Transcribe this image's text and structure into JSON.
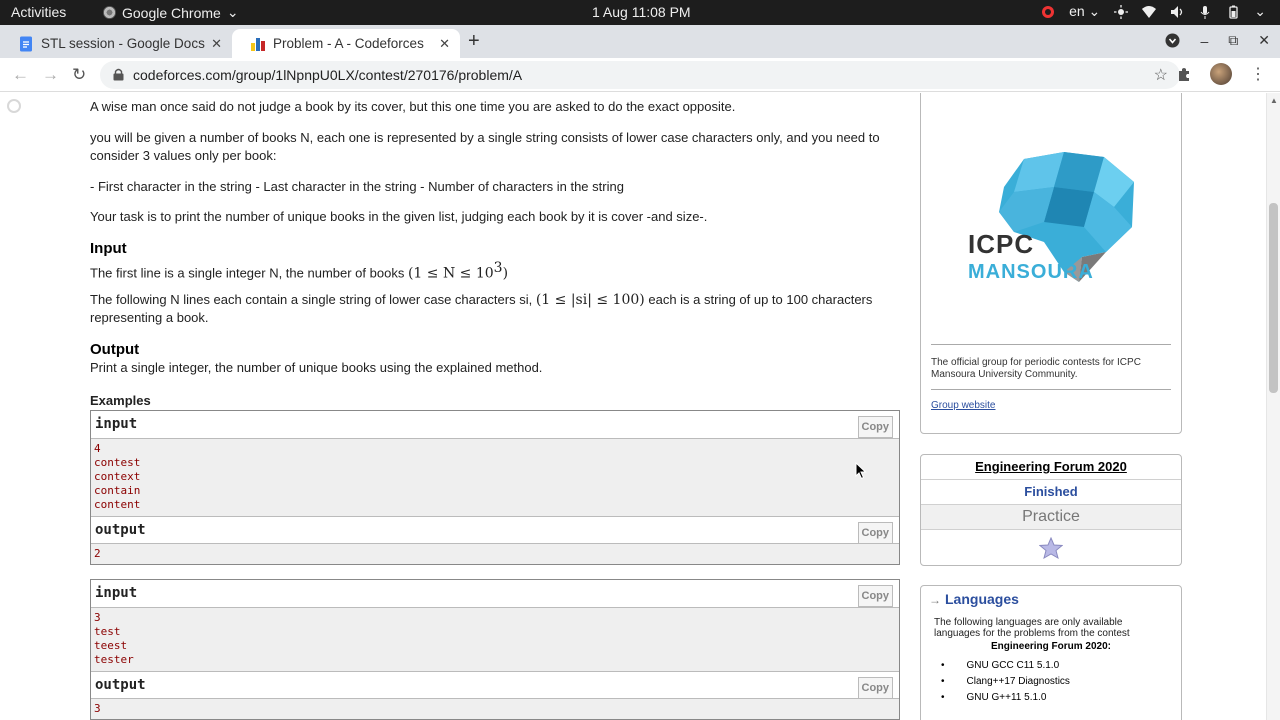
{
  "system_bar": {
    "activities": "Activities",
    "app_name": "Google Chrome",
    "clock": "1 Aug  11:08 PM",
    "language": "en"
  },
  "tabs": [
    {
      "title": "STL session - Google Docs",
      "icon": "google-docs-icon"
    },
    {
      "title": "Problem - A - Codeforces",
      "icon": "codeforces-icon"
    }
  ],
  "address_bar": {
    "url": "codeforces.com/group/1lNpnpU0LX/contest/270176/problem/A"
  },
  "problem": {
    "statement_1": "A wise man once said do not judge a book by its cover, but this one time you are asked to do the exact opposite.",
    "statement_2": "you will be given a number of books N, each one is represented by a single string consists of lower case characters only, and you need to consider 3 values only per book:",
    "statement_3": "- First character in the string - Last character in the string - Number of characters in the string",
    "statement_4": "Your task is to print the number of unique books in the given list, judging each book by it is cover -and size-.",
    "input_title": "Input",
    "input_line_1_text": "The first line is a single integer N, the number of books ",
    "input_line_1_math": "(1 ≤ N ≤ 10",
    "input_line_1_exp": "3",
    "input_line_1_close": ")",
    "input_line_2_text": "The following N lines each contain a single string of lower case characters si, ",
    "input_line_2_math": "(1 ≤ |si| ≤ 100)",
    "input_line_2_rest": " each is a string of up to 100 characters representing a book.",
    "output_title": "Output",
    "output_text": "Print a single integer, the number of unique books using the explained method.",
    "examples_title": "Examples",
    "copy_label": "Copy",
    "input_label": "input",
    "output_label": "output",
    "examples": [
      {
        "input": "4\ncontest\ncontext\ncontain\ncontent",
        "output": "2"
      },
      {
        "input": "3\ntest\nteest\ntester",
        "output": "3"
      }
    ]
  },
  "sidebar": {
    "logo_icpc": "ICPC",
    "logo_mansoura": "MANSOURA",
    "group_description": "The official group for periodic contests for ICPC Mansoura University Community.",
    "group_website": "Group website",
    "contest_name": "Engineering Forum 2020",
    "contest_status": "Finished",
    "practice_label": "Practice",
    "languages_title": "Languages",
    "languages_desc": "The following languages are only available languages for the problems from the contest",
    "languages_subtitle": "Engineering Forum 2020:",
    "languages": [
      "GNU GCC C11 5.1.0",
      "Clang++17 Diagnostics",
      "GNU G++11 5.1.0"
    ]
  },
  "colors": {
    "link": "#2b4e9e",
    "sample_text": "#8b0000",
    "brain": "#3aaed8"
  }
}
